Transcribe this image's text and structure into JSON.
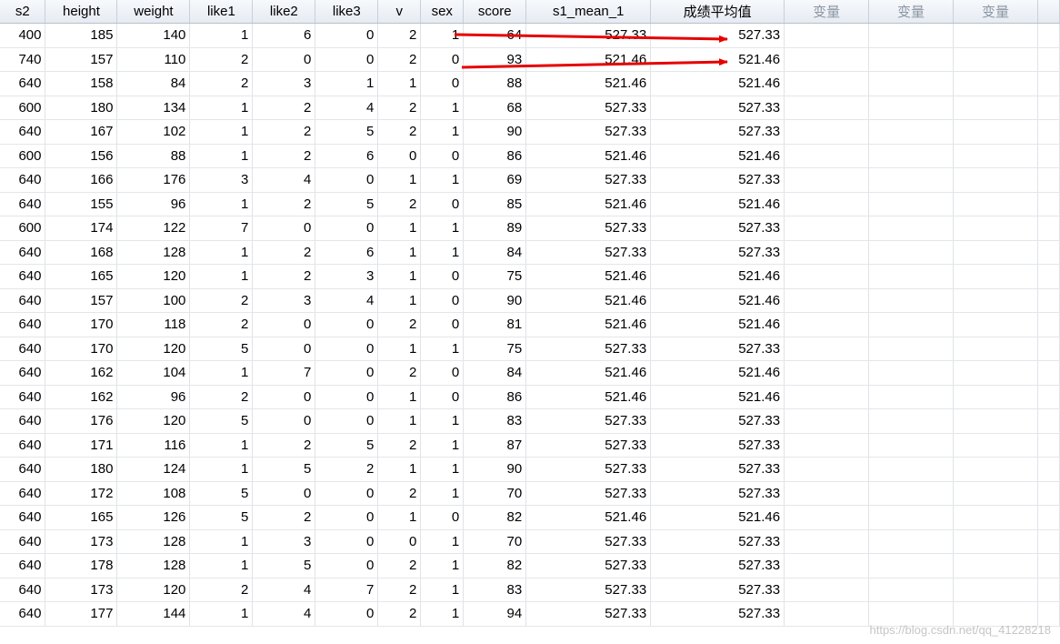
{
  "columns": [
    {
      "key": "s2",
      "label": "s2"
    },
    {
      "key": "height",
      "label": "height"
    },
    {
      "key": "weight",
      "label": "weight"
    },
    {
      "key": "like1",
      "label": "like1"
    },
    {
      "key": "like2",
      "label": "like2"
    },
    {
      "key": "like3",
      "label": "like3"
    },
    {
      "key": "v",
      "label": "v"
    },
    {
      "key": "sex",
      "label": "sex"
    },
    {
      "key": "score",
      "label": "score"
    },
    {
      "key": "s1_mean_1",
      "label": "s1_mean_1"
    },
    {
      "key": "score_avg",
      "label": "成绩平均值"
    },
    {
      "key": "var1",
      "label": "变量",
      "placeholder": true
    },
    {
      "key": "var2",
      "label": "变量",
      "placeholder": true
    },
    {
      "key": "var3",
      "label": "变量",
      "placeholder": true
    },
    {
      "key": "var4",
      "label": "",
      "placeholder": true
    }
  ],
  "rows": [
    [
      "400",
      "185",
      "140",
      "1",
      "6",
      "0",
      "2",
      "1",
      "64",
      "527.33",
      "527.33"
    ],
    [
      "740",
      "157",
      "110",
      "2",
      "0",
      "0",
      "2",
      "0",
      "93",
      "521.46",
      "521.46"
    ],
    [
      "640",
      "158",
      "84",
      "2",
      "3",
      "1",
      "1",
      "0",
      "88",
      "521.46",
      "521.46"
    ],
    [
      "600",
      "180",
      "134",
      "1",
      "2",
      "4",
      "2",
      "1",
      "68",
      "527.33",
      "527.33"
    ],
    [
      "640",
      "167",
      "102",
      "1",
      "2",
      "5",
      "2",
      "1",
      "90",
      "527.33",
      "527.33"
    ],
    [
      "600",
      "156",
      "88",
      "1",
      "2",
      "6",
      "0",
      "0",
      "86",
      "521.46",
      "521.46"
    ],
    [
      "640",
      "166",
      "176",
      "3",
      "4",
      "0",
      "1",
      "1",
      "69",
      "527.33",
      "527.33"
    ],
    [
      "640",
      "155",
      "96",
      "1",
      "2",
      "5",
      "2",
      "0",
      "85",
      "521.46",
      "521.46"
    ],
    [
      "600",
      "174",
      "122",
      "7",
      "0",
      "0",
      "1",
      "1",
      "89",
      "527.33",
      "527.33"
    ],
    [
      "640",
      "168",
      "128",
      "1",
      "2",
      "6",
      "1",
      "1",
      "84",
      "527.33",
      "527.33"
    ],
    [
      "640",
      "165",
      "120",
      "1",
      "2",
      "3",
      "1",
      "0",
      "75",
      "521.46",
      "521.46"
    ],
    [
      "640",
      "157",
      "100",
      "2",
      "3",
      "4",
      "1",
      "0",
      "90",
      "521.46",
      "521.46"
    ],
    [
      "640",
      "170",
      "118",
      "2",
      "0",
      "0",
      "2",
      "0",
      "81",
      "521.46",
      "521.46"
    ],
    [
      "640",
      "170",
      "120",
      "5",
      "0",
      "0",
      "1",
      "1",
      "75",
      "527.33",
      "527.33"
    ],
    [
      "640",
      "162",
      "104",
      "1",
      "7",
      "0",
      "2",
      "0",
      "84",
      "521.46",
      "521.46"
    ],
    [
      "640",
      "162",
      "96",
      "2",
      "0",
      "0",
      "1",
      "0",
      "86",
      "521.46",
      "521.46"
    ],
    [
      "640",
      "176",
      "120",
      "5",
      "0",
      "0",
      "1",
      "1",
      "83",
      "527.33",
      "527.33"
    ],
    [
      "640",
      "171",
      "116",
      "1",
      "2",
      "5",
      "2",
      "1",
      "87",
      "527.33",
      "527.33"
    ],
    [
      "640",
      "180",
      "124",
      "1",
      "5",
      "2",
      "1",
      "1",
      "90",
      "527.33",
      "527.33"
    ],
    [
      "640",
      "172",
      "108",
      "5",
      "0",
      "0",
      "2",
      "1",
      "70",
      "527.33",
      "527.33"
    ],
    [
      "640",
      "165",
      "126",
      "5",
      "2",
      "0",
      "1",
      "0",
      "82",
      "521.46",
      "521.46"
    ],
    [
      "640",
      "173",
      "128",
      "1",
      "3",
      "0",
      "0",
      "1",
      "70",
      "527.33",
      "527.33"
    ],
    [
      "640",
      "178",
      "128",
      "1",
      "5",
      "0",
      "2",
      "1",
      "82",
      "527.33",
      "527.33"
    ],
    [
      "640",
      "173",
      "120",
      "2",
      "4",
      "7",
      "2",
      "1",
      "83",
      "527.33",
      "527.33"
    ],
    [
      "640",
      "177",
      "144",
      "1",
      "4",
      "0",
      "2",
      "1",
      "94",
      "527.33",
      "527.33"
    ]
  ],
  "annotation_color": "#e60000",
  "watermark": "https://blog.csdn.net/qq_41228218"
}
